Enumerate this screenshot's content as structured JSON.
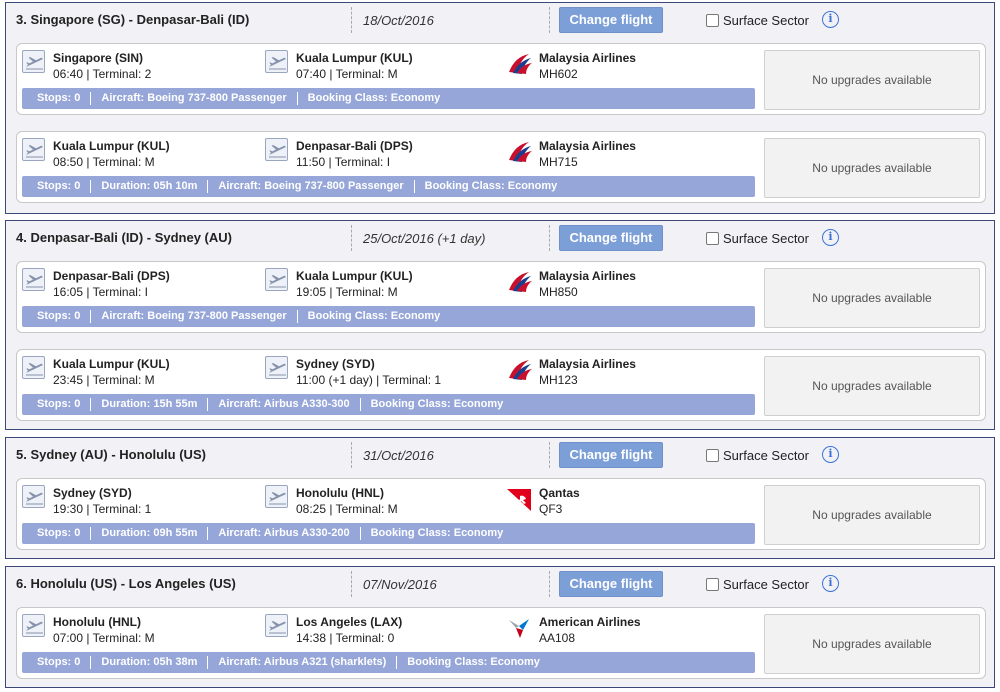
{
  "controls": {
    "change_flight_label": "Change flight",
    "surface_sector_label": "Surface Sector",
    "info_glyph": "i"
  },
  "sectors": [
    {
      "title": "3. Singapore (SG) - Denpasar-Bali (ID)",
      "date": "18/Oct/2016",
      "flights": [
        {
          "from_city": "Singapore (SIN)",
          "from_detail": "06:40 | Terminal: 2",
          "to_city": "Kuala Lumpur (KUL)",
          "to_detail": "07:40 | Terminal: M",
          "airline": "Malaysia Airlines",
          "airline_icon": "malaysia-airlines-logo",
          "flight_no": "MH602",
          "info": [
            "Stops: 0",
            "Aircraft: Boeing 737-800 Passenger",
            "Booking Class: Economy"
          ],
          "upgrade_text": "No upgrades available"
        },
        {
          "from_city": "Kuala Lumpur (KUL)",
          "from_detail": "08:50 | Terminal: M",
          "to_city": "Denpasar-Bali (DPS)",
          "to_detail": "11:50 | Terminal: I",
          "airline": "Malaysia Airlines",
          "airline_icon": "malaysia-airlines-logo",
          "flight_no": "MH715",
          "info": [
            "Stops: 0",
            "Duration: 05h 10m",
            "Aircraft: Boeing 737-800 Passenger",
            "Booking Class: Economy"
          ],
          "upgrade_text": "No upgrades available"
        }
      ]
    },
    {
      "title": "4. Denpasar-Bali (ID) - Sydney (AU)",
      "date": "25/Oct/2016 (+1 day)",
      "flights": [
        {
          "from_city": "Denpasar-Bali (DPS)",
          "from_detail": "16:05 | Terminal: I",
          "to_city": "Kuala Lumpur (KUL)",
          "to_detail": "19:05 | Terminal: M",
          "airline": "Malaysia Airlines",
          "airline_icon": "malaysia-airlines-logo",
          "flight_no": "MH850",
          "info": [
            "Stops: 0",
            "Aircraft: Boeing 737-800 Passenger",
            "Booking Class: Economy"
          ],
          "upgrade_text": "No upgrades available"
        },
        {
          "from_city": "Kuala Lumpur (KUL)",
          "from_detail": "23:45 | Terminal: M",
          "to_city": "Sydney (SYD)",
          "to_detail": "11:00 (+1 day) | Terminal: 1",
          "airline": "Malaysia Airlines",
          "airline_icon": "malaysia-airlines-logo",
          "flight_no": "MH123",
          "info": [
            "Stops: 0",
            "Duration: 15h 55m",
            "Aircraft: Airbus A330-300",
            "Booking Class: Economy"
          ],
          "upgrade_text": "No upgrades available"
        }
      ]
    },
    {
      "title": "5. Sydney (AU) - Honolulu (US)",
      "date": "31/Oct/2016",
      "flights": [
        {
          "from_city": "Sydney (SYD)",
          "from_detail": "19:30 | Terminal: 1",
          "to_city": "Honolulu (HNL)",
          "to_detail": "08:25 | Terminal: M",
          "airline": "Qantas",
          "airline_icon": "qantas-logo",
          "flight_no": "QF3",
          "info": [
            "Stops: 0",
            "Duration: 09h 55m",
            "Aircraft: Airbus A330-200",
            "Booking Class: Economy"
          ],
          "upgrade_text": "No upgrades available"
        }
      ]
    },
    {
      "title": "6. Honolulu (US) - Los Angeles (US)",
      "date": "07/Nov/2016",
      "flights": [
        {
          "from_city": "Honolulu (HNL)",
          "from_detail": "07:00 | Terminal: M",
          "to_city": "Los Angeles (LAX)",
          "to_detail": "14:38 | Terminal: 0",
          "airline": "American Airlines",
          "airline_icon": "american-airlines-logo",
          "flight_no": "AA108",
          "info": [
            "Stops: 0",
            "Duration: 05h 38m",
            "Aircraft: Airbus A321 (sharklets)",
            "Booking Class: Economy"
          ],
          "upgrade_text": "No upgrades available"
        }
      ]
    }
  ]
}
